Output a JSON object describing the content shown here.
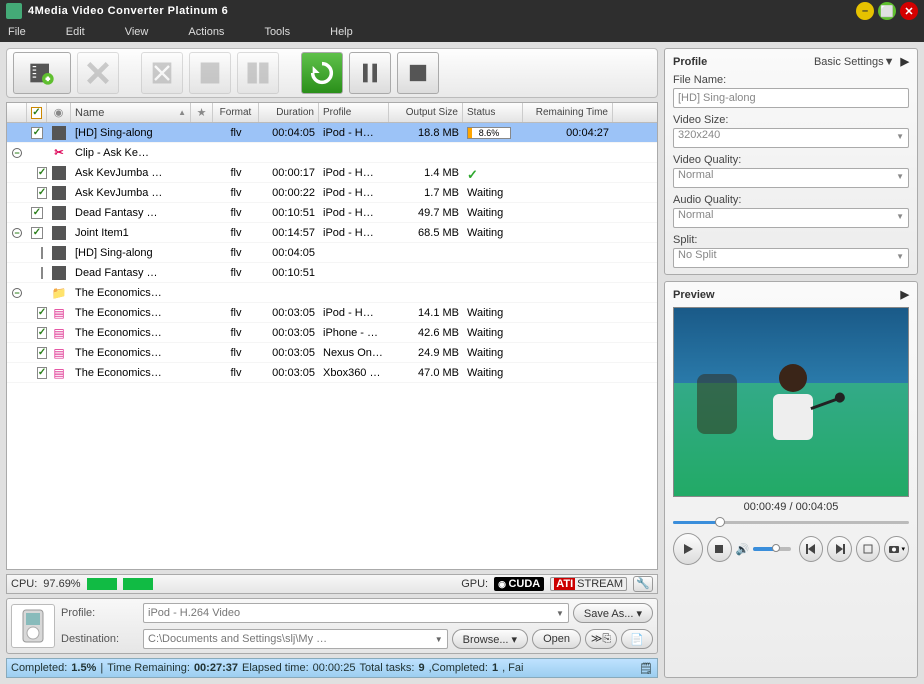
{
  "app": {
    "title": "4Media Video Converter Platinum 6"
  },
  "menu": {
    "file": "File",
    "edit": "Edit",
    "view": "View",
    "actions": "Actions",
    "tools": "Tools",
    "help": "Help"
  },
  "columns": {
    "name": "Name",
    "format": "Format",
    "duration": "Duration",
    "profile": "Profile",
    "output_size": "Output Size",
    "status": "Status",
    "remaining": "Remaining Time"
  },
  "rows": [
    {
      "indent": 0,
      "toggle": "",
      "checked": true,
      "type": "video",
      "name": "[HD] Sing-along",
      "format": "flv",
      "duration": "00:04:05",
      "profile": "iPod - H…",
      "size": "18.8 MB",
      "status_kind": "progress",
      "status": "8.6%",
      "progress_pct": 8.6,
      "remaining": "00:04:27",
      "selected": true
    },
    {
      "indent": 0,
      "toggle": "-",
      "checked": false,
      "type": "clip",
      "name": "Clip - Ask Ke…",
      "format": "",
      "duration": "",
      "profile": "",
      "size": "",
      "status_kind": "",
      "status": "",
      "remaining": ""
    },
    {
      "indent": 1,
      "toggle": "",
      "checked": true,
      "type": "video",
      "name": "Ask KevJumba …",
      "format": "flv",
      "duration": "00:00:17",
      "profile": "iPod - H…",
      "size": "1.4 MB",
      "status_kind": "done",
      "status": "",
      "remaining": ""
    },
    {
      "indent": 1,
      "toggle": "",
      "checked": true,
      "type": "video",
      "name": "Ask KevJumba …",
      "format": "flv",
      "duration": "00:00:22",
      "profile": "iPod - H…",
      "size": "1.7 MB",
      "status_kind": "text",
      "status": "Waiting",
      "remaining": ""
    },
    {
      "indent": 0,
      "toggle": "",
      "checked": true,
      "type": "video",
      "name": "Dead Fantasy …",
      "format": "flv",
      "duration": "00:10:51",
      "profile": "iPod - H…",
      "size": "49.7 MB",
      "status_kind": "text",
      "status": "Waiting",
      "remaining": ""
    },
    {
      "indent": 0,
      "toggle": "-",
      "checked": true,
      "type": "video",
      "name": "Joint Item1",
      "format": "flv",
      "duration": "00:14:57",
      "profile": "iPod - H…",
      "size": "68.5 MB",
      "status_kind": "text",
      "status": "Waiting",
      "remaining": ""
    },
    {
      "indent": 1,
      "toggle": "",
      "checked": false,
      "type": "video",
      "name": "[HD] Sing-along",
      "format": "flv",
      "duration": "00:04:05",
      "profile": "",
      "size": "",
      "status_kind": "",
      "status": "",
      "remaining": ""
    },
    {
      "indent": 1,
      "toggle": "",
      "checked": false,
      "type": "video",
      "name": "Dead Fantasy …",
      "format": "flv",
      "duration": "00:10:51",
      "profile": "",
      "size": "",
      "status_kind": "",
      "status": "",
      "remaining": ""
    },
    {
      "indent": 0,
      "toggle": "-",
      "checked": false,
      "type": "folder",
      "name": "The Economics…",
      "format": "",
      "duration": "",
      "profile": "",
      "size": "",
      "status_kind": "",
      "status": "",
      "remaining": ""
    },
    {
      "indent": 1,
      "toggle": "",
      "checked": true,
      "type": "doc",
      "name": "The Economics…",
      "format": "flv",
      "duration": "00:03:05",
      "profile": "iPod - H…",
      "size": "14.1 MB",
      "status_kind": "text",
      "status": "Waiting",
      "remaining": ""
    },
    {
      "indent": 1,
      "toggle": "",
      "checked": true,
      "type": "doc",
      "name": "The Economics…",
      "format": "flv",
      "duration": "00:03:05",
      "profile": "iPhone - …",
      "size": "42.6 MB",
      "status_kind": "text",
      "status": "Waiting",
      "remaining": ""
    },
    {
      "indent": 1,
      "toggle": "",
      "checked": true,
      "type": "doc",
      "name": "The Economics…",
      "format": "flv",
      "duration": "00:03:05",
      "profile": "Nexus On…",
      "size": "24.9 MB",
      "status_kind": "text",
      "status": "Waiting",
      "remaining": ""
    },
    {
      "indent": 1,
      "toggle": "",
      "checked": true,
      "type": "doc",
      "name": "The Economics…",
      "format": "flv",
      "duration": "00:03:05",
      "profile": "Xbox360 …",
      "size": "47.0 MB",
      "status_kind": "text",
      "status": "Waiting",
      "remaining": ""
    }
  ],
  "cpu": {
    "label": "CPU:",
    "value": "97.69%",
    "gpu_label": "GPU:",
    "cuda": "CUDA",
    "ati": "STREAM",
    "ati_brand": "ATI"
  },
  "bottom": {
    "profile_label": "Profile:",
    "profile_value": "iPod - H.264 Video",
    "save_as": "Save As... ▾",
    "dest_label": "Destination:",
    "dest_value": "C:\\Documents and Settings\\slj\\My …",
    "browse": "Browse... ▾",
    "open": "Open"
  },
  "status": {
    "completed_label": "Completed:",
    "completed_value": "1.5%",
    "remaining_label": "Time Remaining:",
    "remaining_value": "00:27:37",
    "elapsed_label": "Elapsed time:",
    "elapsed_value": "00:00:25",
    "tasks_label": "Total tasks:",
    "tasks_value": "9",
    "done_label": ",Completed:",
    "done_value": "1",
    "tail": ", Fai"
  },
  "profile_panel": {
    "title": "Profile",
    "settings": "Basic Settings▼",
    "filename_label": "File Name:",
    "filename_value": "[HD] Sing-along",
    "videosize_label": "Video Size:",
    "videosize_value": "320x240",
    "vq_label": "Video Quality:",
    "vq_value": "Normal",
    "aq_label": "Audio Quality:",
    "aq_value": "Normal",
    "split_label": "Split:",
    "split_value": "No Split"
  },
  "preview": {
    "title": "Preview",
    "time": "00:00:49 / 00:04:05"
  }
}
